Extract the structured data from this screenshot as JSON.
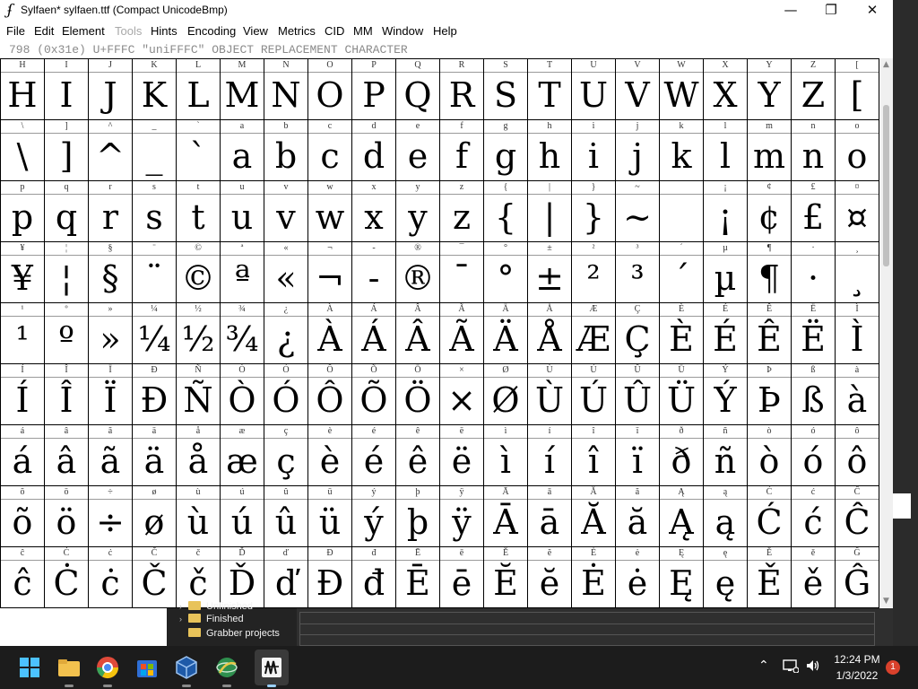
{
  "window": {
    "title": "Sylfaen* sylfaen.ttf (Compact UnicodeBmp)",
    "minimize": "—",
    "maximize": "❐",
    "close": "✕"
  },
  "menu": [
    "File",
    "Edit",
    "Element",
    "Tools",
    "Hints",
    "Encoding",
    "View",
    "Metrics",
    "CID",
    "MM",
    "Window",
    "Help"
  ],
  "menu_disabled": [
    "Tools"
  ],
  "info": "798 (0x31e) U+FFFC \"uniFFFC\" OBJECT REPLACEMENT CHARACTER",
  "grid": {
    "rows": [
      {
        "labels": [
          "H",
          "I",
          "J",
          "K",
          "L",
          "M",
          "N",
          "O",
          "P",
          "Q",
          "R",
          "S",
          "T",
          "U",
          "V",
          "W",
          "X",
          "Y",
          "Z",
          "["
        ],
        "glyphs": [
          "H",
          "I",
          "J",
          "K",
          "L",
          "M",
          "N",
          "O",
          "P",
          "Q",
          "R",
          "S",
          "T",
          "U",
          "V",
          "W",
          "X",
          "Y",
          "Z",
          "["
        ]
      },
      {
        "labels": [
          "\\",
          "]",
          "^",
          "_",
          "`",
          "a",
          "b",
          "c",
          "d",
          "e",
          "f",
          "g",
          "h",
          "i",
          "j",
          "k",
          "l",
          "m",
          "n",
          "o"
        ],
        "glyphs": [
          "\\",
          "]",
          "^",
          "_",
          "`",
          "a",
          "b",
          "c",
          "d",
          "e",
          "f",
          "g",
          "h",
          "i",
          "j",
          "k",
          "l",
          "m",
          "n",
          "o"
        ]
      },
      {
        "labels": [
          "p",
          "q",
          "r",
          "s",
          "t",
          "u",
          "v",
          "w",
          "x",
          "y",
          "z",
          "{",
          "|",
          "}",
          "~",
          "",
          "¡",
          "¢",
          "£",
          "¤"
        ],
        "glyphs": [
          "p",
          "q",
          "r",
          "s",
          "t",
          "u",
          "v",
          "w",
          "x",
          "y",
          "z",
          "{",
          "|",
          "}",
          "~",
          "",
          "¡",
          "¢",
          "£",
          "¤"
        ]
      },
      {
        "labels": [
          "¥",
          "¦",
          "§",
          "¨",
          "©",
          "ª",
          "«",
          "¬",
          "-",
          "®",
          "¯",
          "°",
          "±",
          "²",
          "³",
          "´",
          "µ",
          "¶",
          "·",
          "¸"
        ],
        "glyphs": [
          "¥",
          "¦",
          "§",
          "¨",
          "©",
          "ª",
          "«",
          "¬",
          "-",
          "®",
          "¯",
          "°",
          "±",
          "²",
          "³",
          "´",
          "µ",
          "¶",
          "·",
          "¸"
        ]
      },
      {
        "labels": [
          "¹",
          "º",
          "»",
          "¼",
          "½",
          "¾",
          "¿",
          "À",
          "Á",
          "Â",
          "Ã",
          "Ä",
          "Å",
          "Æ",
          "Ç",
          "È",
          "É",
          "Ê",
          "Ë",
          "Ì"
        ],
        "glyphs": [
          "¹",
          "º",
          "»",
          "¼",
          "½",
          "¾",
          "¿",
          "À",
          "Á",
          "Â",
          "Ã",
          "Ä",
          "Å",
          "Æ",
          "Ç",
          "È",
          "É",
          "Ê",
          "Ë",
          "Ì"
        ]
      },
      {
        "labels": [
          "Í",
          "Î",
          "Ï",
          "Ð",
          "Ñ",
          "Ò",
          "Ó",
          "Ô",
          "Õ",
          "Ö",
          "×",
          "Ø",
          "Ù",
          "Ú",
          "Û",
          "Ü",
          "Ý",
          "Þ",
          "ß",
          "à"
        ],
        "glyphs": [
          "Í",
          "Î",
          "Ï",
          "Ð",
          "Ñ",
          "Ò",
          "Ó",
          "Ô",
          "Õ",
          "Ö",
          "×",
          "Ø",
          "Ù",
          "Ú",
          "Û",
          "Ü",
          "Ý",
          "Þ",
          "ß",
          "à"
        ]
      },
      {
        "labels": [
          "á",
          "â",
          "ã",
          "ä",
          "å",
          "æ",
          "ç",
          "è",
          "é",
          "ê",
          "ë",
          "ì",
          "í",
          "î",
          "ï",
          "ð",
          "ñ",
          "ò",
          "ó",
          "ô"
        ],
        "glyphs": [
          "á",
          "â",
          "ã",
          "ä",
          "å",
          "æ",
          "ç",
          "è",
          "é",
          "ê",
          "ë",
          "ì",
          "í",
          "î",
          "ï",
          "ð",
          "ñ",
          "ò",
          "ó",
          "ô"
        ]
      },
      {
        "labels": [
          "õ",
          "ö",
          "÷",
          "ø",
          "ù",
          "ú",
          "û",
          "ü",
          "ý",
          "þ",
          "ÿ",
          "Ā",
          "ā",
          "Ă",
          "ă",
          "Ą",
          "ą",
          "Ć",
          "ć",
          "Ĉ"
        ],
        "glyphs": [
          "õ",
          "ö",
          "÷",
          "ø",
          "ù",
          "ú",
          "û",
          "ü",
          "ý",
          "þ",
          "ÿ",
          "Ā",
          "ā",
          "Ă",
          "ă",
          "Ą",
          "ą",
          "Ć",
          "ć",
          "Ĉ"
        ]
      },
      {
        "labels": [
          "ĉ",
          "Ċ",
          "ċ",
          "Č",
          "č",
          "Ď",
          "ď",
          "Đ",
          "đ",
          "Ē",
          "ē",
          "Ĕ",
          "ĕ",
          "Ė",
          "ė",
          "Ę",
          "ę",
          "Ě",
          "ě",
          "Ĝ"
        ],
        "glyphs": [
          "ĉ",
          "Ċ",
          "ċ",
          "Č",
          "č",
          "Ď",
          "ď",
          "Đ",
          "đ",
          "Ē",
          "ē",
          "Ĕ",
          "ĕ",
          "Ė",
          "ė",
          "Ę",
          "ę",
          "Ě",
          "ě",
          "Ĝ"
        ]
      }
    ]
  },
  "explorer": {
    "items": [
      "Unfinished",
      "Finished",
      "Grabber projects"
    ]
  },
  "taskbar": {
    "apps": [
      {
        "name": "start",
        "icon": "windows-icon",
        "color": "#3a8ee6"
      },
      {
        "name": "file-explorer",
        "icon": "folder-icon",
        "color": "#e8b53a"
      },
      {
        "name": "chrome",
        "icon": "chrome-icon",
        "color": "#e04a3a"
      },
      {
        "name": "store",
        "icon": "store-icon",
        "color": "#3b7ce0"
      },
      {
        "name": "virtualbox",
        "icon": "cube-icon",
        "color": "#2a5ea8"
      },
      {
        "name": "network-app",
        "icon": "globe-icon",
        "color": "#3aa55a"
      },
      {
        "name": "fontforge",
        "icon": "fontforge-icon",
        "color": "#f0f0f0"
      }
    ],
    "time": "12:24 PM",
    "date": "1/3/2022",
    "notifications": "1"
  }
}
